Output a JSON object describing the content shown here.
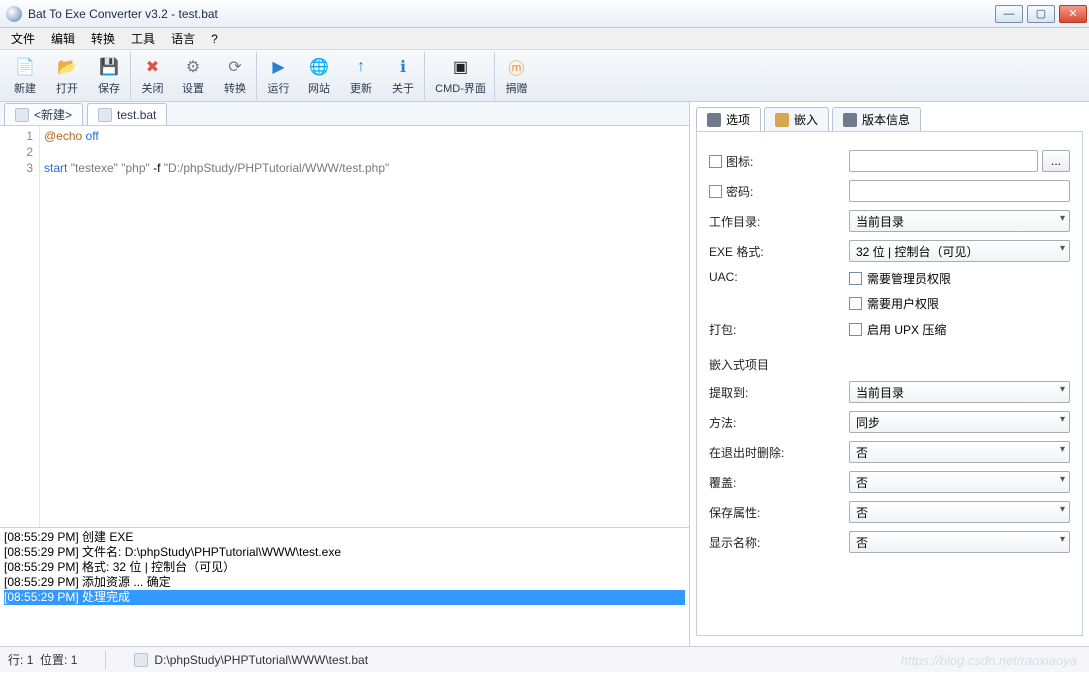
{
  "window": {
    "title": "Bat To Exe Converter v3.2 - test.bat"
  },
  "menu": {
    "items": [
      "文件",
      "编辑",
      "转换",
      "工具",
      "语言",
      "?"
    ]
  },
  "toolbar": {
    "items": [
      {
        "label": "新建",
        "icon": "file-new-icon",
        "color": "#f7f7f7",
        "glyph": "📄"
      },
      {
        "label": "打开",
        "icon": "folder-open-icon",
        "color": "#f7d98c",
        "glyph": "📂"
      },
      {
        "label": "保存",
        "icon": "save-icon",
        "color": "#5a7399",
        "glyph": "💾"
      },
      {
        "label": "关闭",
        "icon": "close-icon",
        "color": "#d9534f",
        "glyph": "✖",
        "sep": true
      },
      {
        "label": "设置",
        "icon": "settings-icon",
        "color": "#6f7b8a",
        "glyph": "⚙"
      },
      {
        "label": "转换",
        "icon": "convert-icon",
        "color": "#6f7b8a",
        "glyph": "⟳"
      },
      {
        "label": "运行",
        "icon": "play-icon",
        "color": "#2a7fd4",
        "glyph": "▶",
        "sep": true
      },
      {
        "label": "网站",
        "icon": "globe-icon",
        "color": "#2a7fd4",
        "glyph": "🌐"
      },
      {
        "label": "更新",
        "icon": "update-icon",
        "color": "#2a7fd4",
        "glyph": "↑"
      },
      {
        "label": "关于",
        "icon": "info-icon",
        "color": "#2a7fd4",
        "glyph": "ℹ"
      },
      {
        "label": "CMD-界面",
        "icon": "cmd-icon",
        "color": "#222",
        "glyph": "▣",
        "sep": true,
        "wide": true
      },
      {
        "label": "捐赠",
        "icon": "donate-icon",
        "color": "#f0902a",
        "glyph": "ⓜ",
        "sep": true
      }
    ]
  },
  "fileTabs": {
    "tabs": [
      {
        "label": "<新建>",
        "active": false
      },
      {
        "label": "test.bat",
        "active": true
      }
    ]
  },
  "editor": {
    "gutter": [
      "1",
      "2",
      "3"
    ],
    "lines": [
      {
        "parts": [
          {
            "cls": "dir",
            "t": "@echo"
          },
          {
            "cls": "",
            "t": " "
          },
          {
            "cls": "kw",
            "t": "off"
          }
        ]
      },
      {
        "parts": []
      },
      {
        "parts": [
          {
            "cls": "kw",
            "t": "start"
          },
          {
            "cls": "",
            "t": " "
          },
          {
            "cls": "str",
            "t": "\"testexe\" \"php\""
          },
          {
            "cls": "",
            "t": " -f "
          },
          {
            "cls": "str",
            "t": "\"D:/phpStudy/PHPTutorial/WWW/test.php\""
          }
        ]
      }
    ]
  },
  "log": {
    "lines": [
      {
        "t": "[08:55:29 PM] 创建 EXE",
        "sel": false
      },
      {
        "t": "[08:55:29 PM] 文件名: D:\\phpStudy\\PHPTutorial\\WWW\\test.exe",
        "sel": false
      },
      {
        "t": "[08:55:29 PM] 格式: 32 位 | 控制台（可见）",
        "sel": false
      },
      {
        "t": "[08:55:29 PM] 添加资源 ... 确定",
        "sel": false
      },
      {
        "t": "[08:55:29 PM] 处理完成",
        "sel": true
      }
    ]
  },
  "rightTabs": {
    "tabs": [
      {
        "label": "选项",
        "active": true
      },
      {
        "label": "嵌入",
        "active": false
      },
      {
        "label": "版本信息",
        "active": false
      }
    ]
  },
  "options": {
    "icon_label": "图标:",
    "icon_value": "",
    "pwd_label": "密码:",
    "pwd_value": "",
    "wd_label": "工作目录:",
    "wd_value": "当前目录",
    "fmt_label": "EXE 格式:",
    "fmt_value": "32 位 | 控制台（可见）",
    "uac_label": "UAC:",
    "uac_admin": "需要管理员权限",
    "uac_user": "需要用户权限",
    "pack_label": "打包:",
    "pack_upx": "启用 UPX 压缩",
    "embed_group": "嵌入式项目",
    "extract_label": "提取到:",
    "extract_value": "当前目录",
    "method_label": "方法:",
    "method_value": "同步",
    "delexit_label": "在退出时删除:",
    "delexit_value": "否",
    "overwrite_label": "覆盖:",
    "overwrite_value": "否",
    "attr_label": "保存属性:",
    "attr_value": "否",
    "disp_label": "显示名称:",
    "disp_value": "否",
    "browse_btn": "..."
  },
  "status": {
    "line_label": "行:",
    "line": "1",
    "pos_label": "位置:",
    "pos": "1",
    "path": "D:\\phpStudy\\PHPTutorial\\WWW\\test.bat"
  },
  "watermark": "https://blog.csdn.net/raoxiaoya"
}
